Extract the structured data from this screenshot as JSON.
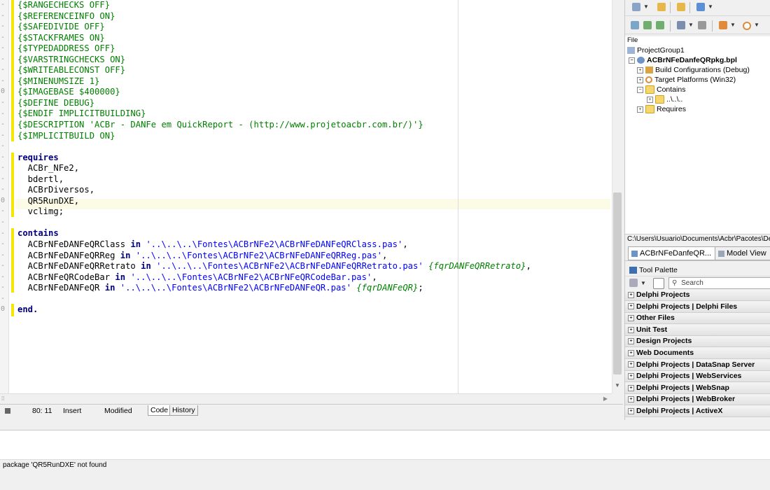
{
  "editor": {
    "gutter": [
      "-",
      "-",
      "-",
      "-",
      "-",
      "-",
      "-",
      "-",
      "0",
      "-",
      "-",
      "-",
      "-",
      "-",
      "-",
      "-",
      "-",
      "-",
      "0",
      "-",
      "-",
      "-",
      "-",
      "-",
      "-",
      "-",
      "-",
      "-",
      "0"
    ],
    "lines": [
      [
        {
          "t": "{$RANGECHECKS OFF}",
          "c": "dir"
        }
      ],
      [
        {
          "t": "{$REFERENCEINFO ON}",
          "c": "dir"
        }
      ],
      [
        {
          "t": "{$SAFEDIVIDE OFF}",
          "c": "dir"
        }
      ],
      [
        {
          "t": "{$STACKFRAMES ON}",
          "c": "dir"
        }
      ],
      [
        {
          "t": "{$TYPEDADDRESS OFF}",
          "c": "dir"
        }
      ],
      [
        {
          "t": "{$VARSTRINGCHECKS ON}",
          "c": "dir"
        }
      ],
      [
        {
          "t": "{$WRITEABLECONST OFF}",
          "c": "dir"
        }
      ],
      [
        {
          "t": "{$MINENUMSIZE 1}",
          "c": "dir"
        }
      ],
      [
        {
          "t": "{$IMAGEBASE $400000}",
          "c": "dir"
        }
      ],
      [
        {
          "t": "{$DEFINE DEBUG}",
          "c": "dir"
        }
      ],
      [
        {
          "t": "{$ENDIF IMPLICITBUILDING}",
          "c": "dir"
        }
      ],
      [
        {
          "t": "{$DESCRIPTION 'ACBr - DANFe em QuickReport - (http://www.projetoacbr.com.br/)'}",
          "c": "dir"
        }
      ],
      [
        {
          "t": "{$IMPLICITBUILD ON}",
          "c": "dir"
        }
      ],
      [
        {
          "t": "",
          "c": "id"
        }
      ],
      [
        {
          "t": "requires",
          "c": "kw"
        }
      ],
      [
        {
          "t": "  ACBr_NFe2,",
          "c": "id"
        }
      ],
      [
        {
          "t": "  bdertl,",
          "c": "id"
        }
      ],
      [
        {
          "t": "  ACBrDiversos,",
          "c": "id"
        }
      ],
      [
        {
          "t": "  QR5RunDXE,",
          "c": "id"
        }
      ],
      [
        {
          "t": "  vclimg;",
          "c": "id"
        }
      ],
      [
        {
          "t": "",
          "c": "id"
        }
      ],
      [
        {
          "t": "contains",
          "c": "kw"
        }
      ],
      [
        {
          "t": "  ACBrNFeDANFeQRClass ",
          "c": "id"
        },
        {
          "t": "in",
          "c": "kw"
        },
        {
          "t": " '..\\..\\..\\Fontes\\ACBrNFe2\\ACBrNFeDANFeQRClass.pas'",
          "c": "str"
        },
        {
          "t": ",",
          "c": "id"
        }
      ],
      [
        {
          "t": "  ACBrNFeDANFeQRReg ",
          "c": "id"
        },
        {
          "t": "in",
          "c": "kw"
        },
        {
          "t": " '..\\..\\..\\Fontes\\ACBrNFe2\\ACBrNFeDANFeQRReg.pas'",
          "c": "str"
        },
        {
          "t": ",",
          "c": "id"
        }
      ],
      [
        {
          "t": "  ACBrNFeDANFeQRRetrato ",
          "c": "id"
        },
        {
          "t": "in",
          "c": "kw"
        },
        {
          "t": " '..\\..\\..\\Fontes\\ACBrNFe2\\ACBrNFeDANFeQRRetrato.pas'",
          "c": "str"
        },
        {
          "t": " {fqrDANFeQRRetrato}",
          "c": "cmt"
        },
        {
          "t": ",",
          "c": "id"
        }
      ],
      [
        {
          "t": "  ACBrNFeQRCodeBar ",
          "c": "id"
        },
        {
          "t": "in",
          "c": "kw"
        },
        {
          "t": " '..\\..\\..\\Fontes\\ACBrNFe2\\ACBrNFeQRCodeBar.pas'",
          "c": "str"
        },
        {
          "t": ",",
          "c": "id"
        }
      ],
      [
        {
          "t": "  ACBrNFeDANFeQR ",
          "c": "id"
        },
        {
          "t": "in",
          "c": "kw"
        },
        {
          "t": " '..\\..\\..\\Fontes\\ACBrNFe2\\ACBrNFeDANFeQR.pas'",
          "c": "str"
        },
        {
          "t": " {fqrDANFeQR}",
          "c": "cmt"
        },
        {
          "t": ";",
          "c": "id"
        }
      ],
      [
        {
          "t": "",
          "c": "id"
        }
      ],
      [
        {
          "t": "end.",
          "c": "kw"
        }
      ]
    ]
  },
  "status": {
    "position": "80: 11",
    "mode": "Insert",
    "state": "Modified",
    "tab_code": "Code",
    "tab_history": "History"
  },
  "messages": {
    "error": "package 'QR5RunDXE' not found"
  },
  "project": {
    "file_header": "File",
    "group": "ProjectGroup1",
    "package": "ACBrNFeDanfeQRpkg.bpl",
    "build_configs": "Build Configurations (Debug)",
    "target_platforms": "Target Platforms (Win32)",
    "contains": "Contains",
    "folder_rel": "..\\..\\..",
    "requires": "Requires",
    "path": "C:\\Users\\Usuario\\Documents\\Acbr\\Pacotes\\De",
    "tab_project": "ACBrNFeDanfeQR...",
    "tab_model": "Model View"
  },
  "palette": {
    "title": "Tool Palette",
    "search_placeholder": "Search",
    "categories": [
      "Delphi Projects",
      "Delphi Projects | Delphi Files",
      "Other Files",
      "Unit Test",
      "Design Projects",
      "Web Documents",
      "Delphi Projects | DataSnap Server",
      "Delphi Projects | WebServices",
      "Delphi Projects | WebSnap",
      "Delphi Projects | WebBroker",
      "Delphi Projects | ActiveX"
    ]
  }
}
